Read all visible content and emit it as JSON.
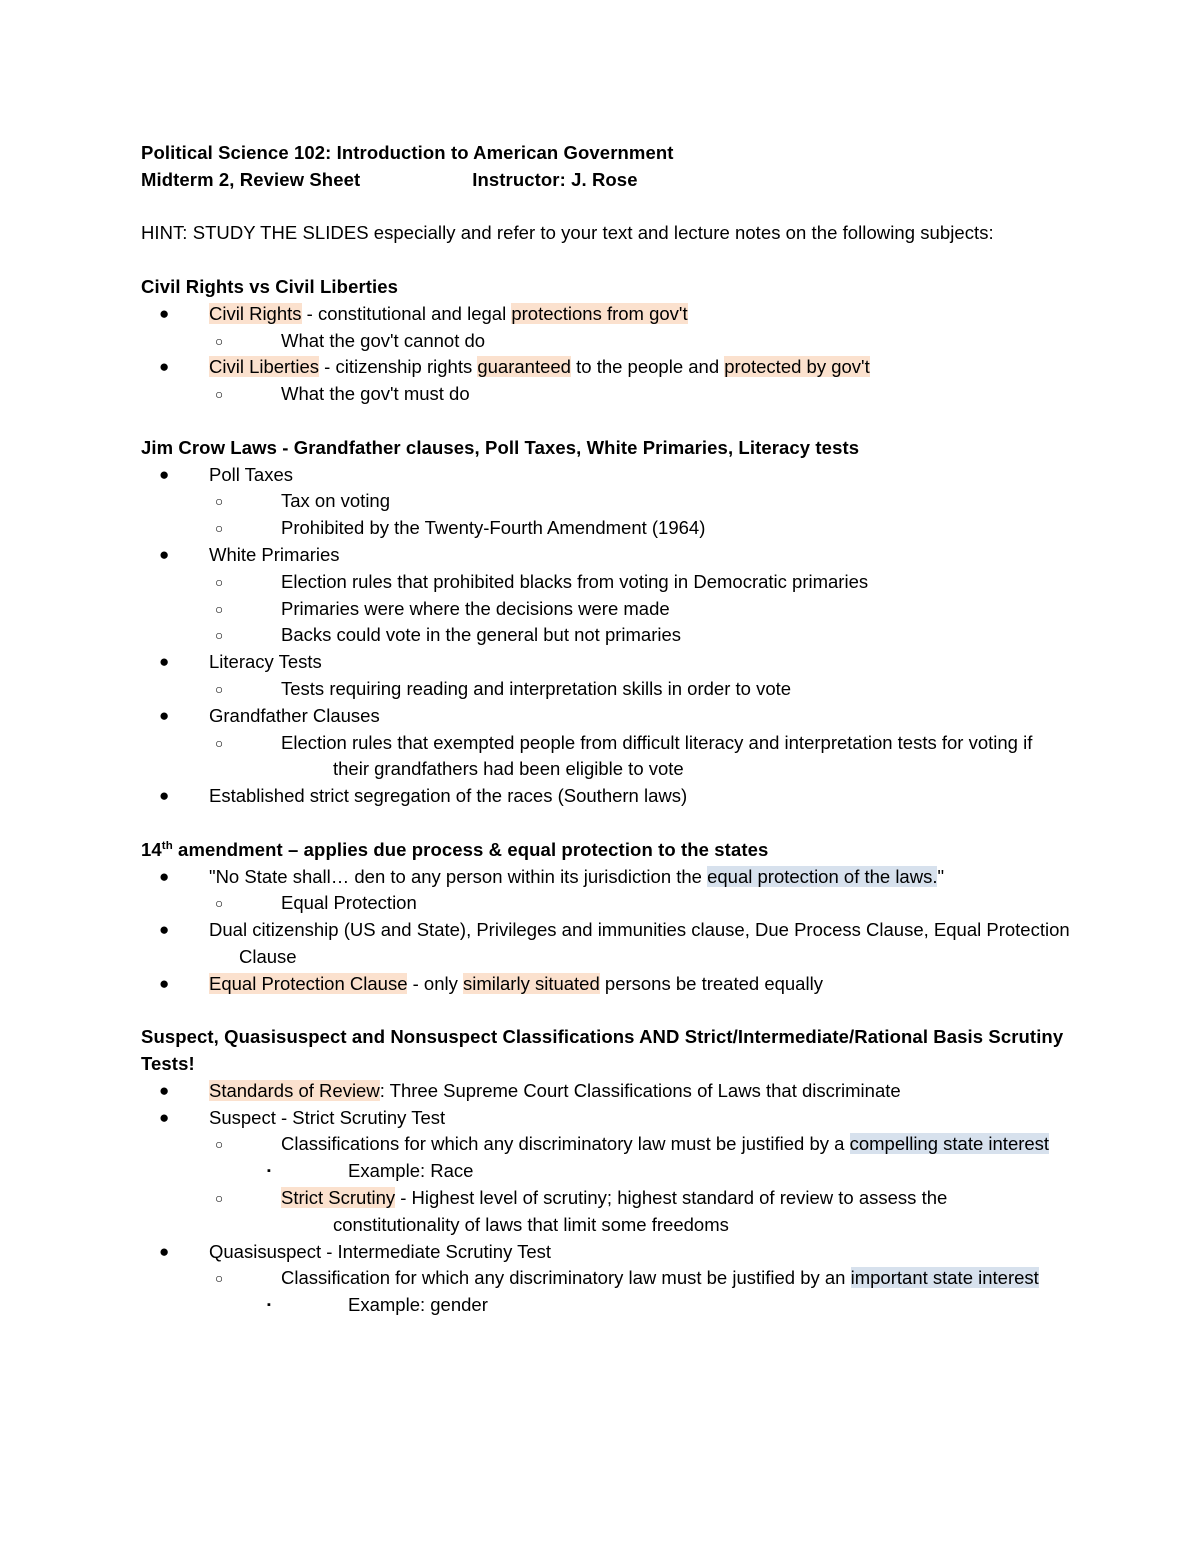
{
  "document": {
    "header": {
      "line1": "Political Science 102: Introduction to American Government",
      "line2_left": "Midterm 2, Review Sheet",
      "line2_right": "Instructor: J. Rose"
    },
    "hint": "HINT: STUDY THE SLIDES especially and refer to your text and lecture notes on the following subjects:",
    "sections": [
      {
        "heading": "Civil Rights vs Civil Liberties",
        "items": [
          {
            "level": 1,
            "bullet": "disc",
            "text": "Civil Rights - constitutional and legal protections from gov't",
            "highlights": [
              {
                "text": "Civil Rights",
                "color": "orange"
              },
              {
                "text": "protections from gov't",
                "color": "orange"
              }
            ]
          },
          {
            "level": 2,
            "bullet": "circle",
            "text": "What the gov't cannot do",
            "highlights": []
          },
          {
            "level": 1,
            "bullet": "disc",
            "text": "Civil Liberties - citizenship rights guaranteed to the people and protected by gov't",
            "highlights": [
              {
                "text": "Civil Liberties",
                "color": "orange"
              },
              {
                "text": "guaranteed",
                "color": "orange"
              },
              {
                "text": "protected by gov't",
                "color": "orange"
              }
            ]
          },
          {
            "level": 2,
            "bullet": "circle",
            "text": "What the gov't must do",
            "highlights": []
          }
        ]
      },
      {
        "heading": "Jim Crow Laws - Grandfather clauses, Poll Taxes, White Primaries, Literacy tests",
        "items": [
          {
            "level": 1,
            "bullet": "disc",
            "text": "Poll Taxes",
            "highlights": []
          },
          {
            "level": 2,
            "bullet": "circle",
            "text": "Tax on voting",
            "highlights": []
          },
          {
            "level": 2,
            "bullet": "circle",
            "text": "Prohibited by the Twenty-Fourth Amendment (1964)",
            "highlights": []
          },
          {
            "level": 1,
            "bullet": "disc",
            "text": "White Primaries",
            "highlights": []
          },
          {
            "level": 2,
            "bullet": "circle",
            "text": "Election rules that prohibited blacks from voting in Democratic primaries",
            "highlights": []
          },
          {
            "level": 2,
            "bullet": "circle",
            "text": "Primaries were where the decisions were made",
            "highlights": []
          },
          {
            "level": 2,
            "bullet": "circle",
            "text": "Backs could vote in the general but not primaries",
            "highlights": []
          },
          {
            "level": 1,
            "bullet": "disc",
            "text": "Literacy Tests",
            "highlights": []
          },
          {
            "level": 2,
            "bullet": "circle",
            "text": "Tests requiring reading and interpretation skills in order to vote",
            "highlights": []
          },
          {
            "level": 1,
            "bullet": "disc",
            "text": "Grandfather Clauses",
            "highlights": []
          },
          {
            "level": 2,
            "bullet": "circle",
            "text": "Election rules that exempted people from difficult literacy and interpretation tests for voting if their grandfathers had been eligible to vote",
            "highlights": []
          },
          {
            "level": 1,
            "bullet": "disc",
            "text": "Established strict segregation of the races (Southern laws)",
            "highlights": []
          }
        ]
      },
      {
        "heading": "14th amendment – applies due process & equal protection to the states",
        "heading_superscript": {
          "base": "14",
          "sup": "th",
          "rest": " amendment – applies due process & equal protection to the states"
        },
        "items": [
          {
            "level": 1,
            "bullet": "disc",
            "text": "\"No State shall… den to any person within its jurisdiction the equal protection of the laws.\"",
            "highlights": [
              {
                "text": "equal protection of the laws.",
                "color": "blue"
              }
            ]
          },
          {
            "level": 2,
            "bullet": "circle",
            "text": "Equal Protection",
            "highlights": []
          },
          {
            "level": 1,
            "bullet": "disc",
            "text": "Dual citizenship (US and State), Privileges and immunities clause, Due Process Clause, Equal Protection Clause",
            "highlights": []
          },
          {
            "level": 1,
            "bullet": "disc",
            "text": "Equal Protection Clause - only similarly situated persons be treated equally",
            "highlights": [
              {
                "text": "Equal Protection Clause",
                "color": "orange"
              },
              {
                "text": "similarly situated",
                "color": "orange"
              }
            ]
          }
        ]
      },
      {
        "heading": "Suspect, Quasisuspect and Nonsuspect Classifications AND Strict/Intermediate/Rational Basis Scrutiny Tests!",
        "items": [
          {
            "level": 1,
            "bullet": "disc",
            "text": "Standards of Review: Three Supreme Court Classifications of Laws that discriminate",
            "highlights": [
              {
                "text": "Standards of Review",
                "color": "orange"
              }
            ]
          },
          {
            "level": 1,
            "bullet": "disc",
            "text": "Suspect - Strict Scrutiny Test",
            "highlights": []
          },
          {
            "level": 2,
            "bullet": "circle",
            "text": "Classifications for which any discriminatory law must be justified by a compelling state interest",
            "highlights": [
              {
                "text": "compelling state interest",
                "color": "blue"
              }
            ]
          },
          {
            "level": 3,
            "bullet": "square",
            "text": "Example: Race",
            "highlights": []
          },
          {
            "level": 2,
            "bullet": "circle",
            "text": "Strict Scrutiny - Highest level of scrutiny; highest standard of review to assess the constitutionality of laws that limit some freedoms",
            "highlights": [
              {
                "text": "Strict Scrutiny",
                "color": "orange"
              }
            ]
          },
          {
            "level": 1,
            "bullet": "disc",
            "text": "Quasisuspect - Intermediate Scrutiny Test",
            "highlights": []
          },
          {
            "level": 2,
            "bullet": "circle",
            "text": "Classification for which any discriminatory law must be justified by an important state interest",
            "highlights": [
              {
                "text": "important state interest",
                "color": "blue"
              }
            ]
          },
          {
            "level": 3,
            "bullet": "square",
            "text": "Example: gender",
            "highlights": []
          }
        ]
      }
    ],
    "colors": {
      "highlight_orange": "#fbe1ce",
      "highlight_blue": "#d7e1ed",
      "text": "#000000",
      "page_background": "#ffffff"
    },
    "bullet_glyphs": {
      "disc": "●",
      "circle": "○",
      "square": "▪"
    }
  }
}
